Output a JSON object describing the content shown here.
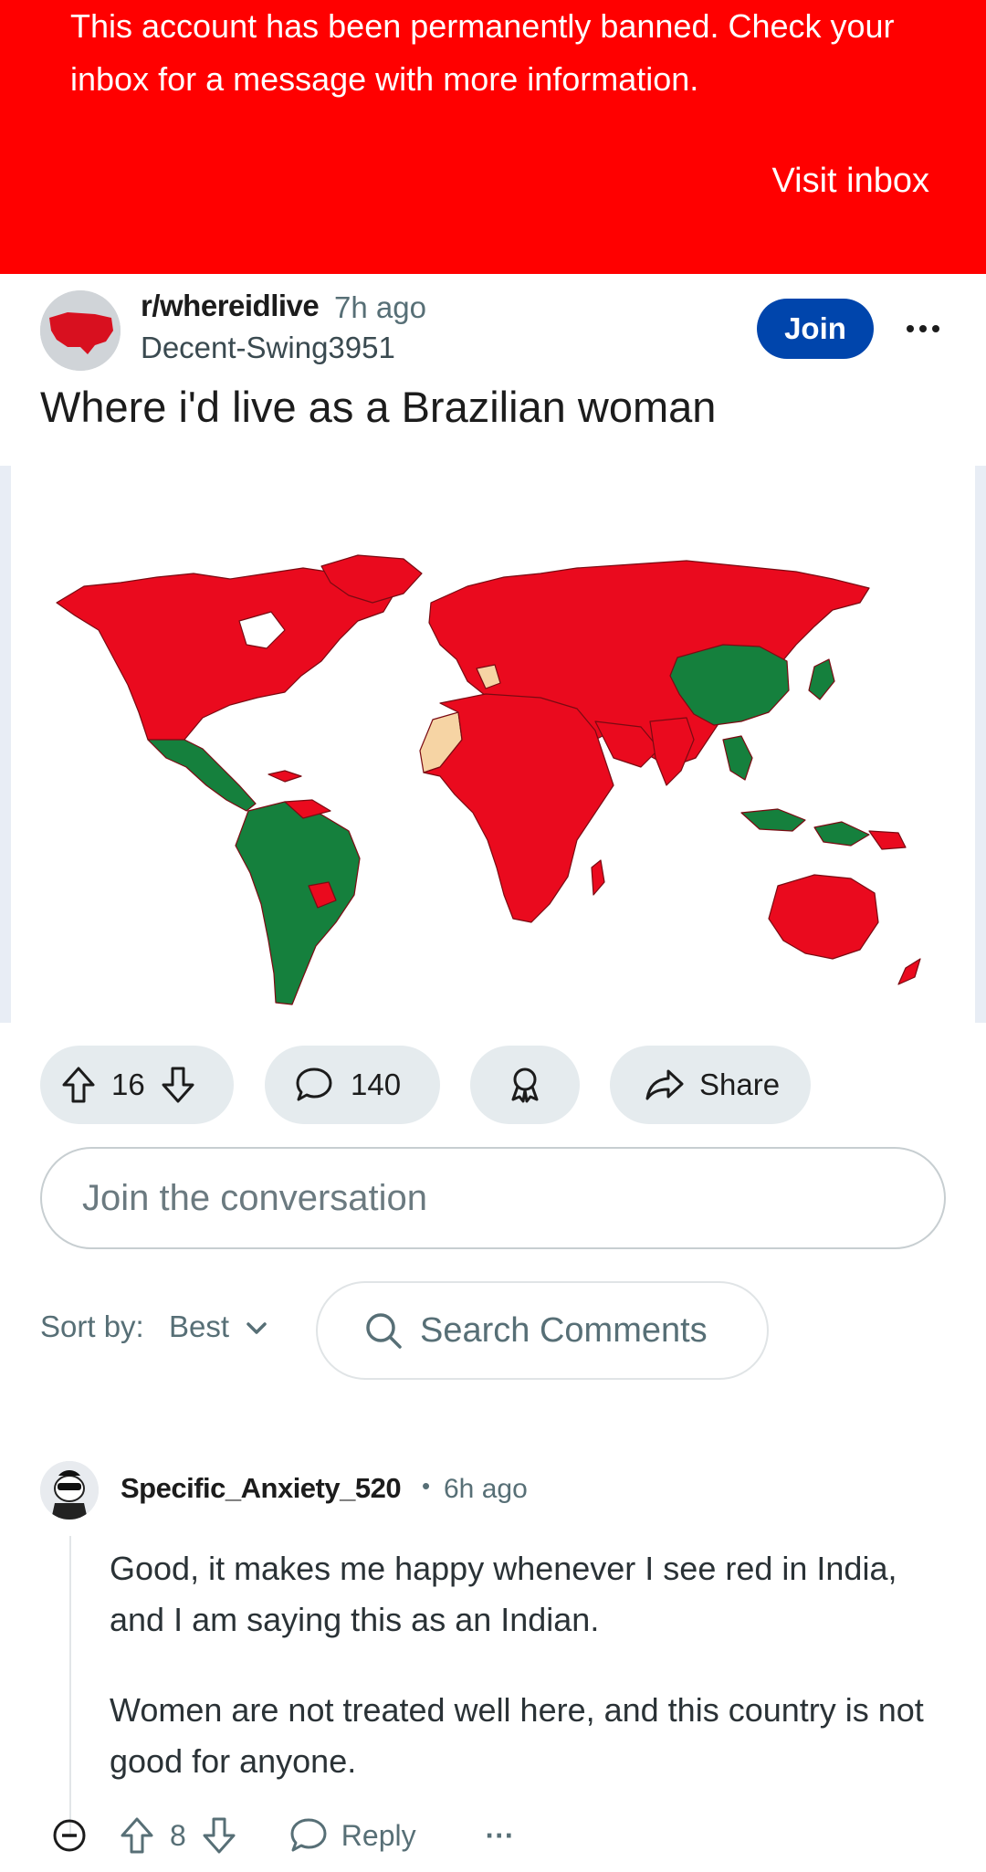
{
  "banner": {
    "message": "This account has been permanently banned. Check your inbox for a message with more information.",
    "link_label": "Visit inbox",
    "bg_color": "#ff0000"
  },
  "post": {
    "subreddit": "r/whereidlive",
    "time": "7h ago",
    "author": "Decent-Swing3951",
    "join_label": "Join",
    "title": "Where i'd live as a Brazilian woman",
    "map_colors": {
      "bad": "#ea0a1e",
      "good": "#15803d",
      "neutral": "#f6d4a4"
    },
    "votes": "16",
    "comments": "140",
    "share_label": "Share"
  },
  "conversation": {
    "placeholder": "Join the conversation"
  },
  "sort": {
    "label": "Sort by:",
    "value": "Best",
    "search_placeholder": "Search Comments"
  },
  "comment": {
    "username": "Specific_Anxiety_520",
    "dot": "•",
    "time": "6h ago",
    "paragraphs": [
      "Good, it makes me happy whenever I see red in India, and I am saying this as an Indian.",
      "Women are not treated well here, and this country is not good for anyone."
    ],
    "votes": "8",
    "reply_label": "Reply",
    "more_label": "···"
  }
}
